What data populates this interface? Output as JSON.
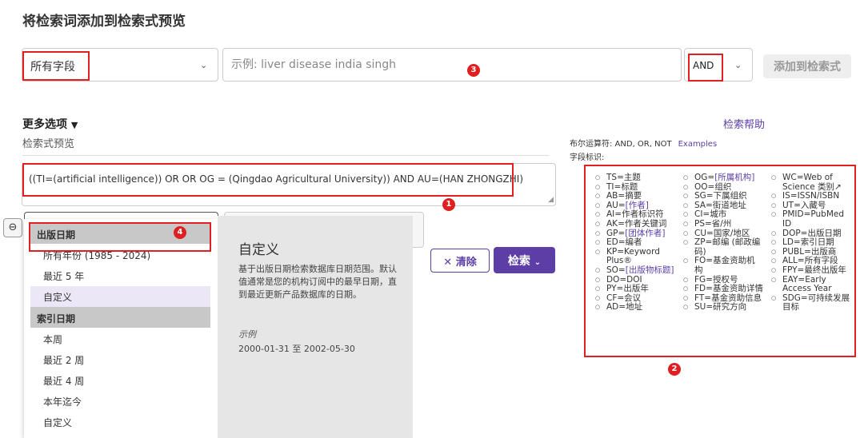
{
  "title": "将检索词添加到检索式预览",
  "search_row": {
    "field_value": "所有字段",
    "search_placeholder": "示例: liver disease india singh",
    "operator_value": "AND",
    "add_button": "添加到检索式"
  },
  "more_options": "更多选项",
  "preview_label": "检索式预览",
  "query_text": "((TI=(artificial intelligence)) OR  OR OG = (Qingdao Agricultural University)) AND AU=(HAN ZHONGZHI)",
  "minus_symbol": "⊖",
  "date_dropdown": {
    "group1": "出版日期",
    "group1_items": [
      "所有年份 (1985 - 2024)",
      "最近 5 年",
      "自定义"
    ],
    "group2": "索引日期",
    "group2_items": [
      "本周",
      "最近 2 周",
      "最近 4 周",
      "本年迄今",
      "自定义"
    ]
  },
  "tooltip": {
    "title": "自定义",
    "desc": "基于出版日期检索数据库日期范围。默认值通常是您的机构订阅中的最早日期，直到最近更新产品数据库的日期。",
    "example_label": "示例",
    "example_value": "2000-01-31 至 2002-05-30"
  },
  "buttons": {
    "clear": "清除",
    "search": "检索"
  },
  "help_link": "检索帮助",
  "bool_ops": "布尔运算符: AND, OR, NOT",
  "examples_link": "Examples",
  "field_tags_label": "字段标识:",
  "field_col1": [
    {
      "code": "TS=",
      "text": "主题"
    },
    {
      "code": "TI=",
      "text": "标题"
    },
    {
      "code": "AB=",
      "text": "摘要"
    },
    {
      "code": "AU=",
      "text": "[作者]",
      "link": true
    },
    {
      "code": "AI=",
      "text": "作者标识符"
    },
    {
      "code": "AK=",
      "text": "作者关键词"
    },
    {
      "code": "GP=",
      "text": "[团体作者]",
      "link": true
    },
    {
      "code": "ED=",
      "text": "编者"
    },
    {
      "code": "KP=",
      "text": "Keyword Plus®"
    },
    {
      "code": "SO=",
      "text": "[出版物标题]",
      "link": true
    },
    {
      "code": "DO=",
      "text": "DOI"
    },
    {
      "code": "PY=",
      "text": "出版年"
    },
    {
      "code": "CF=",
      "text": "会议"
    },
    {
      "code": "AD=",
      "text": "地址"
    }
  ],
  "field_col2": [
    {
      "code": "OG=",
      "text": "[所属机构]",
      "link": true
    },
    {
      "code": "OO=",
      "text": "组织"
    },
    {
      "code": "SG=",
      "text": "下属组织"
    },
    {
      "code": "SA=",
      "text": "街道地址"
    },
    {
      "code": "CI=",
      "text": "城市"
    },
    {
      "code": "PS=",
      "text": "省/州"
    },
    {
      "code": "CU=",
      "text": "国家/地区"
    },
    {
      "code": "ZP=",
      "text": "邮编 (邮政编码)"
    },
    {
      "code": "FO=",
      "text": "基金资助机构"
    },
    {
      "code": "FG=",
      "text": "授权号"
    },
    {
      "code": "FD=",
      "text": "基金资助详情"
    },
    {
      "code": "FT=",
      "text": "基金资助信息"
    },
    {
      "code": "SU=",
      "text": "研究方向"
    }
  ],
  "field_col3": [
    {
      "code": "WC=",
      "text": "Web of Science 类别↗",
      "link_tail": true
    },
    {
      "code": "IS=",
      "text": "ISSN/ISBN"
    },
    {
      "code": "UT=",
      "text": "入藏号"
    },
    {
      "code": "PMID=",
      "text": "PubMed ID"
    },
    {
      "code": "DOP=",
      "text": "出版日期"
    },
    {
      "code": "LD=",
      "text": "索引日期"
    },
    {
      "code": "PUBL=",
      "text": "出版商"
    },
    {
      "code": "ALL=",
      "text": "所有字段"
    },
    {
      "code": "FPY=",
      "text": "最终出版年"
    },
    {
      "code": "EAY=",
      "text": "Early Access Year"
    },
    {
      "code": "SDG=",
      "text": "可持续发展目标"
    }
  ],
  "annotations": [
    "1",
    "2",
    "3",
    "4"
  ],
  "colors": {
    "accent": "#5c3ea6",
    "annotation": "#e02020"
  }
}
